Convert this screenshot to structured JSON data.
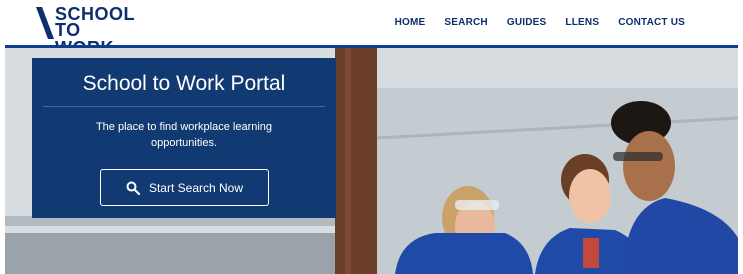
{
  "logo": {
    "line1": "SCHOOL",
    "line2": "TO WORK"
  },
  "nav": [
    {
      "label": "HOME"
    },
    {
      "label": "SEARCH"
    },
    {
      "label": "GUIDES"
    },
    {
      "label": "LLENS"
    },
    {
      "label": "CONTACT US"
    }
  ],
  "hero": {
    "title": "School to Work Portal",
    "subtitle": "The place to find workplace learning opportunities.",
    "button_label": "Start Search Now",
    "button_icon": "search-icon"
  },
  "colors": {
    "brand_navy": "#0d2f6d",
    "panel_bg": "#123a72",
    "header_rule": "#0d3d8c",
    "workwear_blue": "#1f4aa8"
  }
}
